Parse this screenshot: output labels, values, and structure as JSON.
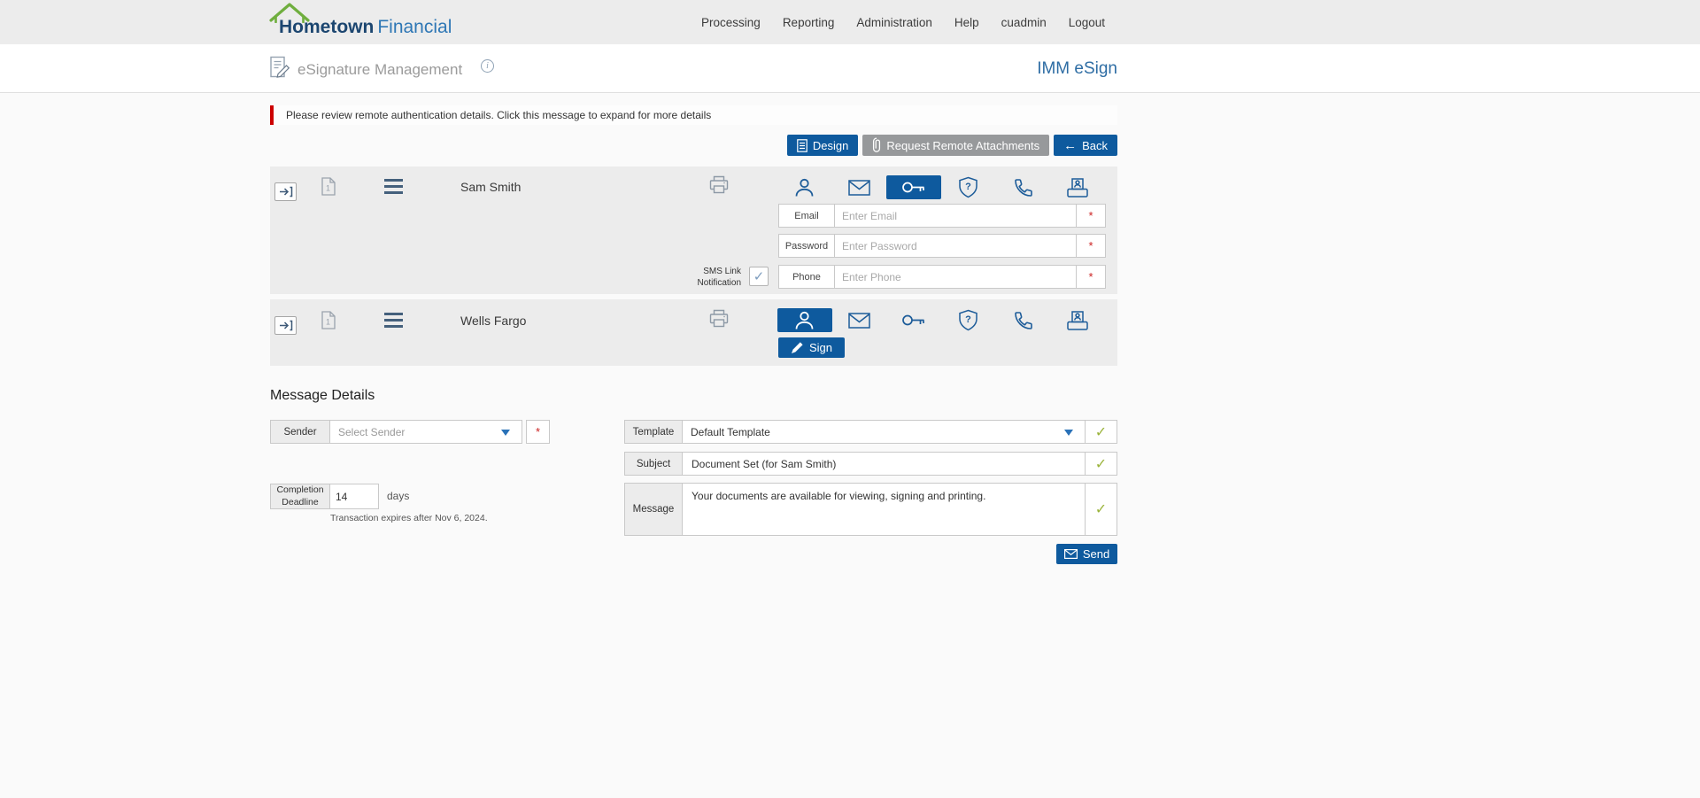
{
  "nav": {
    "brand": {
      "primary": "Hometown",
      "secondary": "Financial"
    },
    "items": [
      {
        "label": "Processing"
      },
      {
        "label": "Reporting"
      },
      {
        "label": "Administration"
      },
      {
        "label": "Help"
      },
      {
        "label": "cuadmin"
      },
      {
        "label": "Logout"
      }
    ]
  },
  "header": {
    "title": "eSignature Management",
    "product": "IMM eSign"
  },
  "alert": {
    "text": "Please review remote authentication details. Click this message to expand for more details"
  },
  "toolbar": {
    "design_label": "Design",
    "request_remote_label": "Request Remote Attachments",
    "back_label": "Back"
  },
  "signers": [
    {
      "name": "Sam Smith",
      "selected_method": "password",
      "sms_label": "SMS Link Notification",
      "fields": [
        {
          "label": "Email",
          "placeholder": "Enter Email"
        },
        {
          "label": "Password",
          "placeholder": "Enter Password"
        },
        {
          "label": "Phone",
          "placeholder": "Enter Phone"
        }
      ]
    },
    {
      "name": "Wells Fargo",
      "selected_method": "in-person",
      "sign_label": "Sign"
    }
  ],
  "message_details": {
    "title": "Message Details",
    "sender": {
      "label": "Sender",
      "placeholder": "Select Sender"
    },
    "completion": {
      "label": "Completion Deadline",
      "value": "14",
      "unit": "days",
      "note": "Transaction expires after Nov 6, 2024."
    },
    "template": {
      "label": "Template",
      "value": "Default Template"
    },
    "subject": {
      "label": "Subject",
      "value": "Document Set (for Sam Smith)"
    },
    "message": {
      "label": "Message",
      "value": "Your documents are available for viewing, signing and printing."
    },
    "send_label": "Send"
  },
  "icons": {
    "back_arrow": "←",
    "check": "✓",
    "asterisk": "*",
    "info": "i"
  },
  "colors": {
    "primary_blue": "#0e5a9e",
    "icon_blue": "#1d5c99",
    "brand_green": "#6fae3e",
    "alert_red": "#cc0000",
    "success_green": "#9bb43c"
  }
}
